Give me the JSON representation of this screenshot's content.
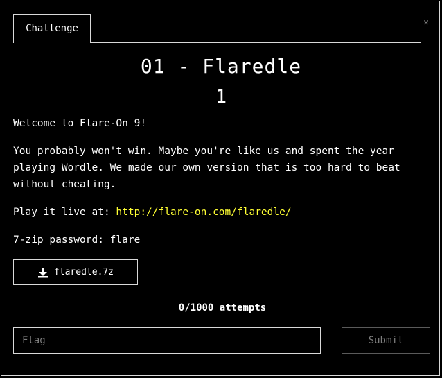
{
  "tabs": [
    {
      "label": "Challenge"
    }
  ],
  "close_icon": "close-icon",
  "challenge": {
    "title": "01 - Flaredle",
    "points": "1",
    "description": {
      "welcome": "Welcome to Flare-On 9!",
      "paragraph": "You probably won't win. Maybe you're like us and spent the year playing Wordle. We made our own version that is too hard to beat without cheating.",
      "play_prefix": "Play it live at: ",
      "play_link": "http://flare-on.com/flaredle/",
      "password": "7-zip password: flare"
    },
    "file": {
      "icon": "download-icon",
      "name": "flaredle.7z"
    },
    "attempts": "0/1000 attempts"
  },
  "form": {
    "flag_placeholder": "Flag",
    "flag_value": "",
    "submit_label": "Submit"
  },
  "colors": {
    "link": "#ffff33",
    "border": "#d9d9d9",
    "muted": "#7f7f7f"
  }
}
